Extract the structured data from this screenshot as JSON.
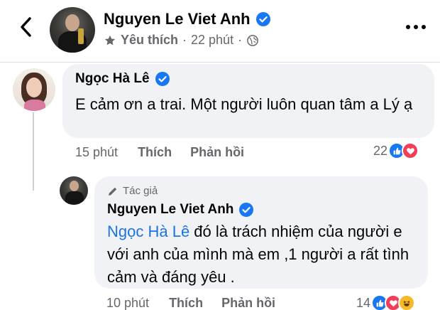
{
  "header": {
    "title": "Nguyen Le Viet Anh",
    "meta_label": "Yêu thích",
    "separator": "·",
    "time": "22 phút",
    "separator2": "·"
  },
  "comments": [
    {
      "author": "Ngọc Hà Lê",
      "text": "E cảm ơn a trai. Một người luôn quan tâm a Lý ạ",
      "time": "15 phút",
      "like_label": "Thích",
      "reply_label": "Phản hồi",
      "reaction_count": "22",
      "reactions": [
        "like",
        "love"
      ]
    },
    {
      "author_badge": "Tác giả",
      "author": "Nguyen Le Viet Anh",
      "mention": "Ngọc Hà Lê",
      "text": " đó là trách nhiệm của người e với anh của mình mà em ,1 người a rất tình cảm và đáng yêu .",
      "time": "10 phút",
      "like_label": "Thích",
      "reply_label": "Phản hồi",
      "reaction_count": "14",
      "reactions": [
        "like",
        "love",
        "haha"
      ]
    }
  ],
  "colors": {
    "verified": "#1877f2",
    "like": "#1877f2",
    "love": "#f33e58",
    "haha": "#f7b928",
    "mention": "#1b74e4"
  }
}
